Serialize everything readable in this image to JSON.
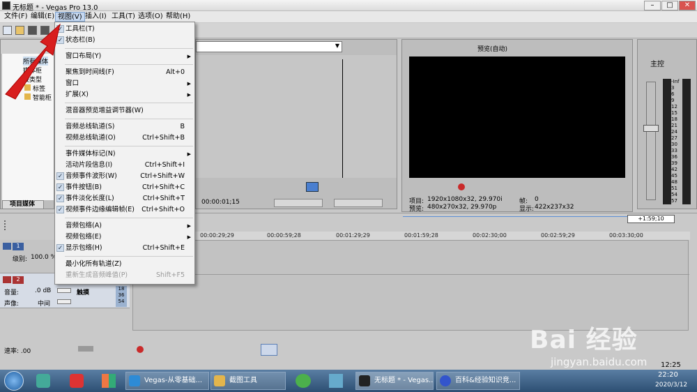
{
  "window": {
    "title": "无标题 * - Vegas Pro 13.0",
    "min": "–",
    "max": "□",
    "close": "✕"
  },
  "menubar": [
    "文件(F)",
    "编辑(E)",
    "视图(V)",
    "插入(I)",
    "工具(T)",
    "选项(O)",
    "帮助(H)"
  ],
  "view_menu": [
    {
      "label": "工具栏(T)",
      "checked": true
    },
    {
      "label": "状态栏(B)",
      "checked": true
    },
    {
      "sep": true
    },
    {
      "label": "窗口布局(Y)",
      "submenu": true
    },
    {
      "sep": true
    },
    {
      "label": "聚焦到时间线(F)",
      "shortcut": "Alt+0"
    },
    {
      "label": "窗口",
      "submenu": true
    },
    {
      "label": "扩展(X)",
      "submenu": true
    },
    {
      "sep": true
    },
    {
      "label": "混音器预览增益调节器(W)"
    },
    {
      "sep": true
    },
    {
      "label": "音频总线轨道(S)",
      "shortcut": "B"
    },
    {
      "label": "视频总线轨道(O)",
      "shortcut": "Ctrl+Shift+B"
    },
    {
      "sep": true
    },
    {
      "label": "事件媒体标记(N)",
      "submenu": true
    },
    {
      "label": "活动片段信息(I)",
      "shortcut": "Ctrl+Shift+I"
    },
    {
      "label": "音频事件波形(W)",
      "shortcut": "Ctrl+Shift+W",
      "checked": true
    },
    {
      "label": "事件按钮(B)",
      "shortcut": "Ctrl+Shift+C",
      "checked": true
    },
    {
      "label": "事件淡化长度(L)",
      "shortcut": "Ctrl+Shift+T",
      "checked": true
    },
    {
      "label": "视频事件边缘编辑帧(E)",
      "shortcut": "Ctrl+Shift+O",
      "checked": true
    },
    {
      "sep": true
    },
    {
      "label": "音频包络(A)",
      "submenu": true
    },
    {
      "label": "视频包络(E)",
      "submenu": true
    },
    {
      "label": "显示包络(H)",
      "shortcut": "Ctrl+Shift+E",
      "checked": true
    },
    {
      "sep": true
    },
    {
      "label": "最小化所有轨道(Z)"
    },
    {
      "label": "重新生成音频峰值(P)",
      "shortcut": "Shift+F5",
      "disabled": true
    }
  ],
  "project_media": {
    "tree": [
      "所有媒体",
      "媒体柜",
      "按类型",
      "标签",
      "智能柜"
    ],
    "tab": "项目媒体"
  },
  "trimmer": {
    "timecode": "00:00:01;15"
  },
  "preview": {
    "mode": "预览(自动)",
    "project_label": "项目:",
    "project_value": "1920x1080x32, 29.970i",
    "preview_label": "预览:",
    "preview_value": "480x270x32, 29.970p",
    "frame_label": "帧:",
    "frame_value": "0",
    "display_label": "显示:",
    "display_value": "422x237x32"
  },
  "master": {
    "title": "主控",
    "scale": [
      "-Inf",
      "3",
      "6",
      "9",
      "12",
      "15",
      "18",
      "21",
      "24",
      "27",
      "30",
      "33",
      "36",
      "39",
      "42",
      "45",
      "48",
      "51",
      "54",
      "57"
    ],
    "top_values": [
      "-00",
      "-00"
    ]
  },
  "timeline": {
    "ruler": [
      "00:00:29;29",
      "00:00:59;28",
      "00:01:29;29",
      "00:01:59;28",
      "00:02:30;00",
      "00:02:59;29",
      "00:03:30;00"
    ],
    "cursor": "+1:59;10",
    "track1": {
      "num": "1",
      "level_label": "级别:",
      "level_value": "100.0 %"
    },
    "track2": {
      "num": "2",
      "vol_label": "音量:",
      "vol_value": ".0 dB",
      "pan_label": "声像:",
      "pan_value": "中间",
      "mode": "触摸",
      "meter": [
        "18",
        "36",
        "54"
      ]
    },
    "rate": "速率: .00",
    "end_time": "12:25"
  },
  "taskbar": {
    "items": [
      {
        "label": "Vegas-从零基础..."
      },
      {
        "label": "截图工具"
      },
      {
        "label": "无标题 * - Vegas..."
      },
      {
        "label": "百科&经验知识竞..."
      }
    ],
    "clock_time": "22:20",
    "clock_date": "2020/3/12"
  },
  "watermark": {
    "brand": "Bai 经验",
    "url": "jingyan.baidu.com"
  },
  "colors": {
    "accent": "#2f6fc7",
    "arrow": "#d81e1e",
    "taskbar": "#3a5d84"
  }
}
